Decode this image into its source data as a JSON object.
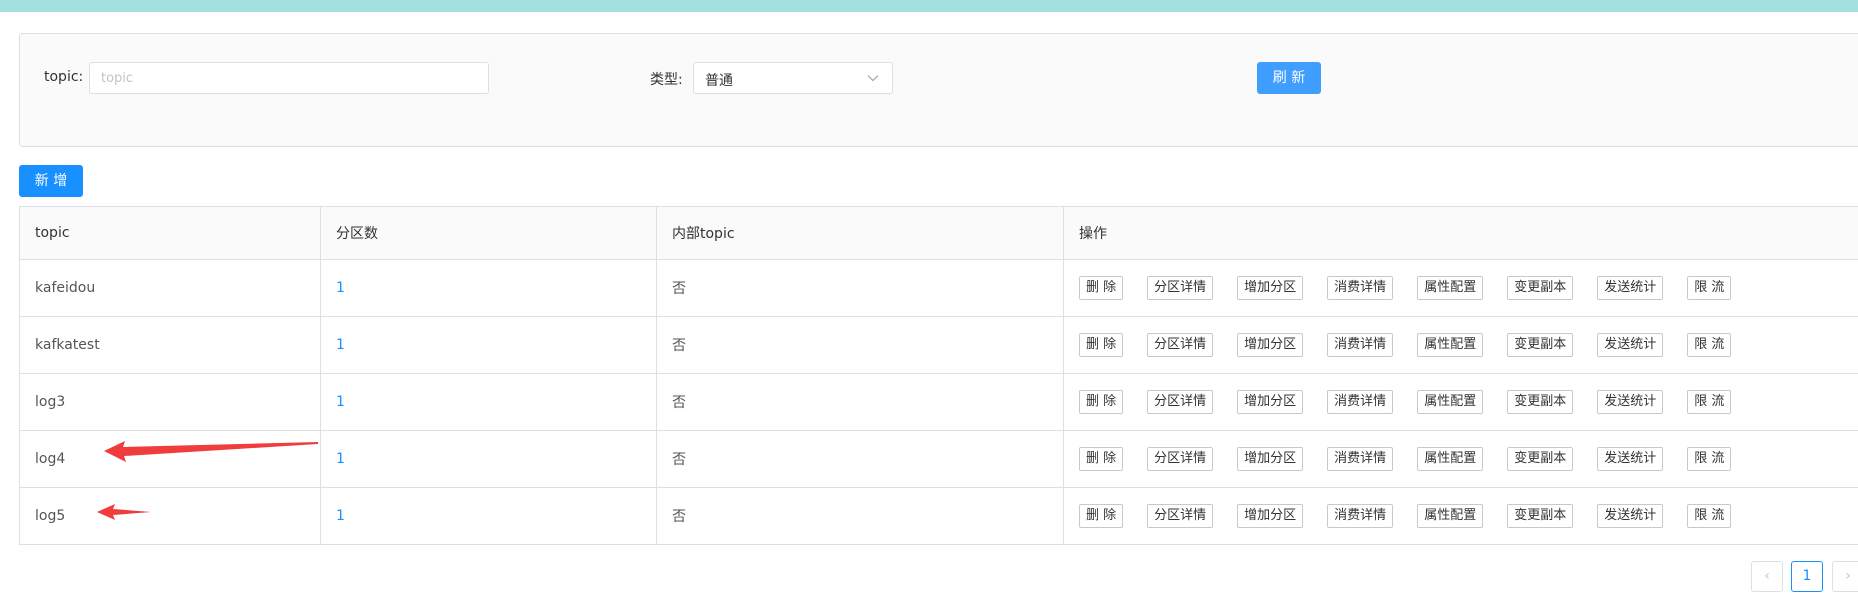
{
  "filters": {
    "topic_label": "topic:",
    "topic_placeholder": "topic",
    "type_label": "类型:",
    "type_value": "普通",
    "refresh_label": "刷 新"
  },
  "add_label": "新 增",
  "table": {
    "headers": [
      "topic",
      "分区数",
      "内部topic",
      "操作"
    ],
    "rows": [
      {
        "topic": "kafeidou",
        "partitions": "1",
        "internal": "否"
      },
      {
        "topic": "kafkatest",
        "partitions": "1",
        "internal": "否"
      },
      {
        "topic": "log3",
        "partitions": "1",
        "internal": "否"
      },
      {
        "topic": "log4",
        "partitions": "1",
        "internal": "否"
      },
      {
        "topic": "log5",
        "partitions": "1",
        "internal": "否"
      }
    ],
    "actions": [
      "删 除",
      "分区详情",
      "增加分区",
      "消费详情",
      "属性配置",
      "变更副本",
      "发送统计",
      "限 流"
    ]
  },
  "pagination": {
    "prev": "‹",
    "current": "1",
    "next": "›"
  },
  "colors": {
    "primary": "#1890ff",
    "refresh": "#409eff",
    "topbar": "#a3e0e0",
    "annotation_arrow": "#f03c3c"
  }
}
